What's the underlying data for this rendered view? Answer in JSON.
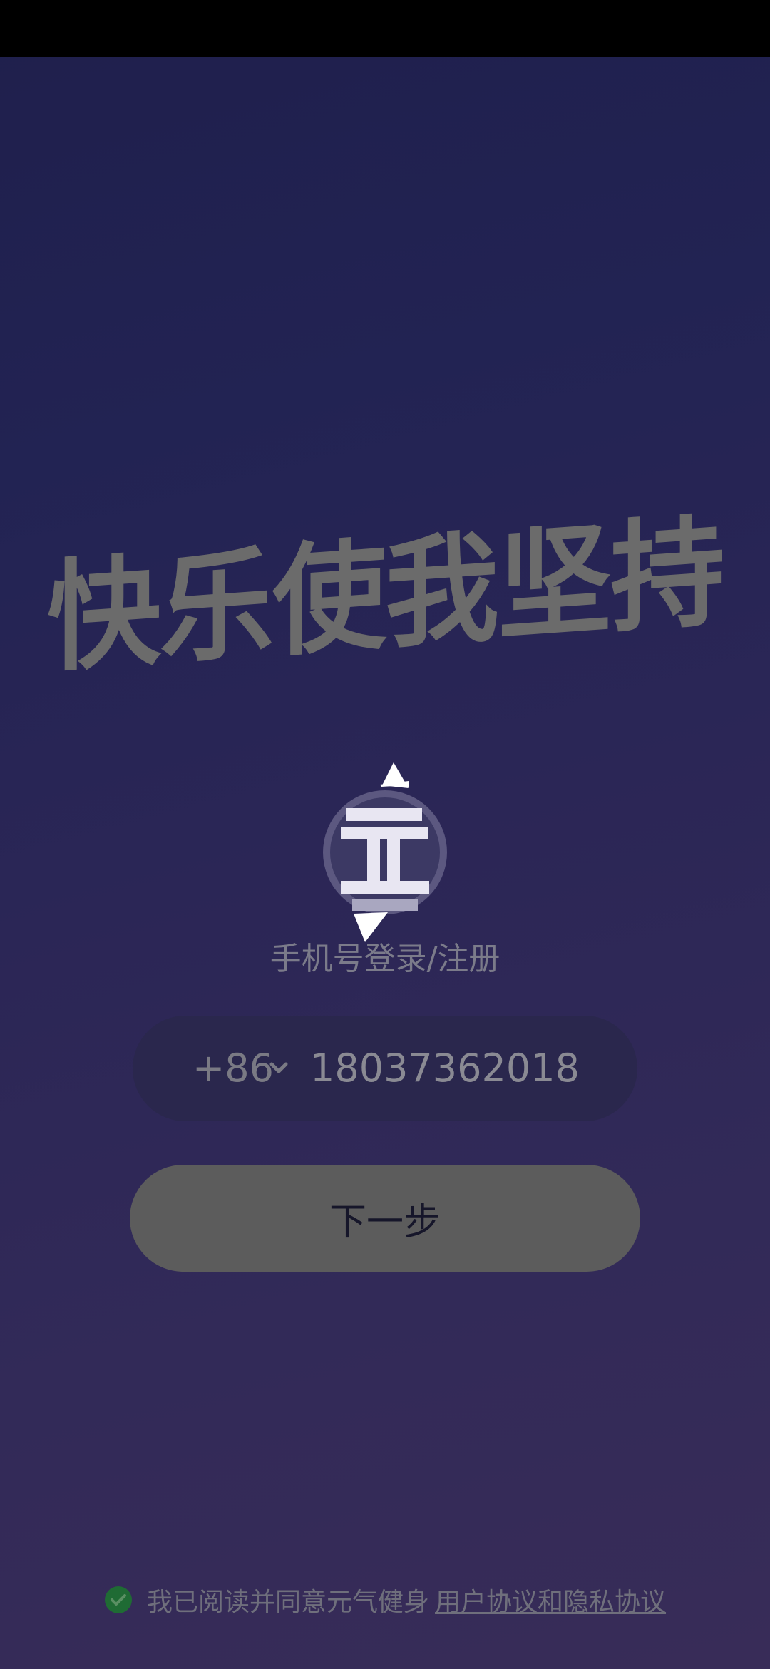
{
  "hero": {
    "slogan": "快乐使我坚持",
    "logo_icon": "yuanqi-logo-icon",
    "subtitle": "手机号登录/注册"
  },
  "phone_input": {
    "country_code": "+86",
    "dropdown_icon": "chevron-down-icon",
    "value": "18037362018"
  },
  "next_button": {
    "label": "下一步"
  },
  "agreement": {
    "checked": true,
    "check_icon": "check-circle-icon",
    "prefix": "我已阅读并同意元气健身",
    "link_label": "用户协议和隐私协议"
  },
  "colors": {
    "background_top": "#1f1f4c",
    "background_bottom": "#382c58",
    "button": "#5c5c5c",
    "check_green": "#1f6b34"
  }
}
